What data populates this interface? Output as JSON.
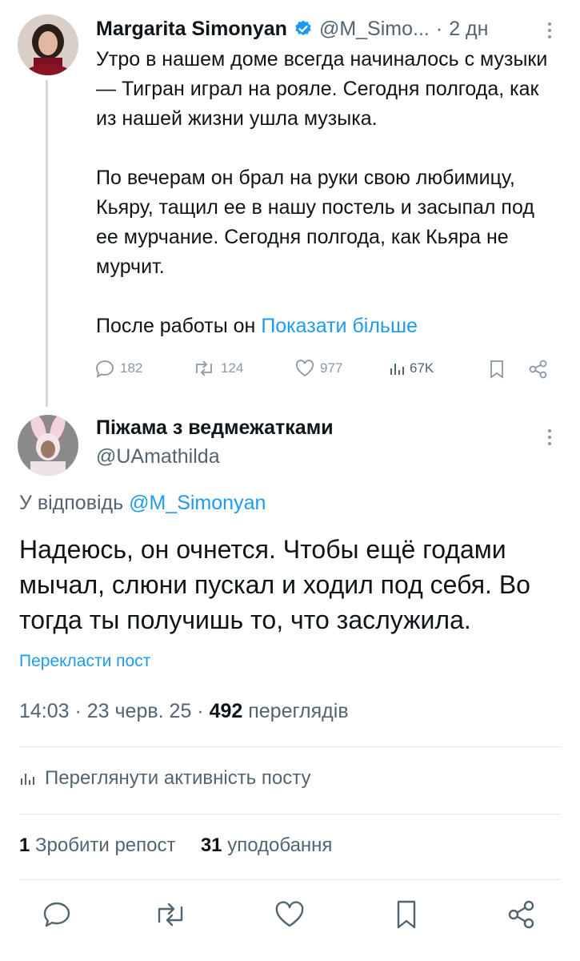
{
  "original_tweet": {
    "author_name": "Margarita Simonyan",
    "handle": "@M_Simo...",
    "separator": "·",
    "time_ago": "2 дн",
    "verified_icon": "verified-badge-icon",
    "paragraph_1": "Утро в нашем доме всегда начиналось с музыки — Тигран играл на рояле. Сегодня полгода, как из нашей жизни ушла музыка.",
    "paragraph_2": "По вечерам он брал на руки свою любимицу, Кьяру, тащил ее в нашу постель и засыпал под ее мурчание. Сегодня полгода, как Кьяра не мурчит.",
    "paragraph_3_start": "После работы он ",
    "show_more": "Показати більше",
    "stats": {
      "replies": "182",
      "reposts": "124",
      "likes": "977",
      "views": "67K"
    }
  },
  "reply_tweet": {
    "author_name": "Піжама з ведмежатками",
    "handle": "@UAmathilda",
    "reply_to_prefix": "У відповідь ",
    "reply_to_handle": "@M_Simonyan",
    "text": "Надеюсь, он очнется. Чтобы ещё годами мычал, слюни пускал и ходил под себя. Во тогда ты получишь то, что заслужила.",
    "translate": "Перекласти пост",
    "time": "14:03",
    "sep1": " · ",
    "date": "23 черв. 25",
    "sep2": " · ",
    "views_count": "492",
    "views_label": " переглядів",
    "activity": "Переглянути активність посту",
    "repost_count": "1",
    "repost_label": "Зробити репост",
    "like_count": "31",
    "like_label": "уподобання"
  },
  "colors": {
    "accent": "#1d9bf0",
    "text": "#0f1419",
    "muted": "#536471"
  }
}
